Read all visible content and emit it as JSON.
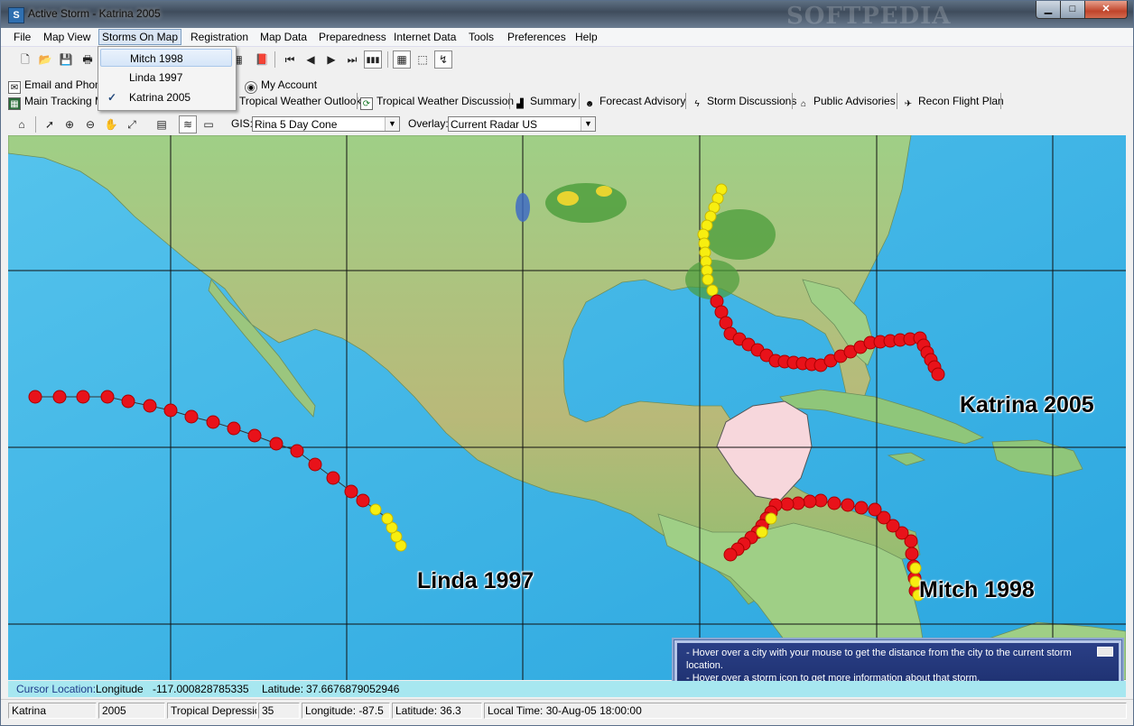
{
  "window": {
    "title": "Active Storm - Katrina 2005",
    "watermark": "SOFTPEDIA",
    "min": "▁",
    "max": "□",
    "close": "✕"
  },
  "menu": [
    "File",
    "Map View",
    "Storms On Map",
    "Registration",
    "Map Data",
    "Preparedness",
    "Internet Data",
    "Tools",
    "Preferences",
    "Help"
  ],
  "storms_menu": {
    "items": [
      {
        "label": "Mitch 1998",
        "checked": false
      },
      {
        "label": "Linda 1997",
        "checked": false
      },
      {
        "label": "Katrina 2005",
        "checked": true
      }
    ],
    "check_glyph": "✓"
  },
  "links_row1": {
    "email": "Email and Phone",
    "account": "My Account"
  },
  "links_row2": [
    "Main Tracking M",
    "Tropical Weather Outlook",
    "Tropical Weather Discussion",
    "Summary",
    "Forecast Advisory",
    "Storm Discussions",
    "Public Advisories",
    "Recon Flight Plan"
  ],
  "gis": {
    "label": "GIS:",
    "value": "Rina 5 Day Cone"
  },
  "overlay": {
    "label": "Overlay:",
    "value": "Current Radar US"
  },
  "storm_labels": {
    "katrina": "Katrina 2005",
    "linda": "Linda 1997",
    "mitch": "Mitch 1998"
  },
  "info": {
    "line1": "- Hover over a city with your mouse to get the distance from the city to the current storm location.",
    "line2": "- Hover over a storm icon to get more information about that storm."
  },
  "cursor": {
    "label": "Cursor Location:",
    "lon_label": "Longitude",
    "lon": "-117.000828785335",
    "lat_label": "Latitude:",
    "lat": "37.6676879052946"
  },
  "status": {
    "name": "Katrina",
    "year": "2005",
    "type": "Tropical Depression",
    "wind": "35",
    "longitude": "Longitude: -87.5",
    "latitude": "Latitude: 36.3",
    "time": "Local Time: 30-Aug-05 18:00:00"
  },
  "colors": {
    "ocean": "#3fb6e3",
    "land": "#8fc67a",
    "track_red": "#e8121a",
    "track_yellow": "#f7ee10",
    "cone": "#f7d7dc",
    "label_text": "#000000"
  }
}
